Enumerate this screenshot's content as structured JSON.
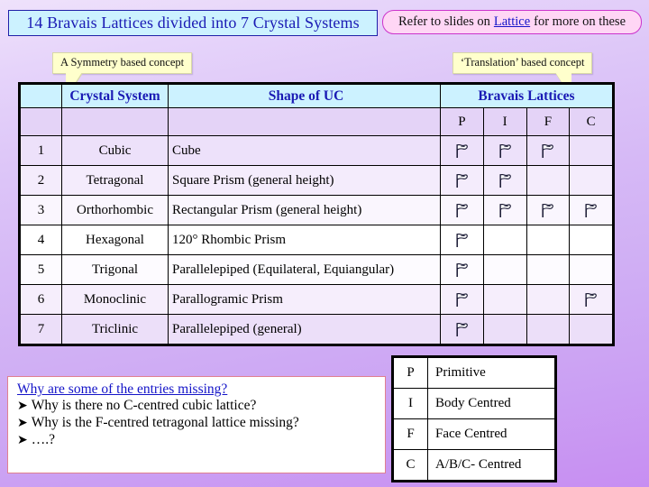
{
  "title_bar": {
    "text": "14 Bravais Lattices divided into 7 Crystal Systems"
  },
  "refer_bar": {
    "before": "Refer to slides on",
    "link": "Lattice",
    "after": "for more on these"
  },
  "callouts": {
    "left": "A Symmetry based concept",
    "right": "‘Translation’ based concept"
  },
  "table": {
    "headers": {
      "blank": "",
      "crystal_system": "Crystal System",
      "shape_of_uc": "Shape of UC",
      "bravais_lattices": "Bravais Lattices"
    },
    "sub_headers": [
      "P",
      "I",
      "F",
      "C"
    ],
    "rows": [
      {
        "num": "1",
        "system": "Cubic",
        "shape": "Cube",
        "P": true,
        "I": true,
        "F": true,
        "C": false
      },
      {
        "num": "2",
        "system": "Tetragonal",
        "shape": "Square Prism (general height)",
        "P": true,
        "I": true,
        "F": false,
        "C": false
      },
      {
        "num": "3",
        "system": "Orthorhombic",
        "shape": "Rectangular Prism (general height)",
        "P": true,
        "I": true,
        "F": true,
        "C": true
      },
      {
        "num": "4",
        "system": "Hexagonal",
        "shape": "120° Rhombic Prism",
        "P": true,
        "I": false,
        "F": false,
        "C": false
      },
      {
        "num": "5",
        "system": "Trigonal",
        "shape": "Parallelepiped (Equilateral, Equiangular)",
        "P": true,
        "I": false,
        "F": false,
        "C": false
      },
      {
        "num": "6",
        "system": "Monoclinic",
        "shape": "Parallogramic Prism",
        "P": true,
        "I": false,
        "F": false,
        "C": true
      },
      {
        "num": "7",
        "system": "Triclinic",
        "shape": "Parallelepiped (general)",
        "P": true,
        "I": false,
        "F": false,
        "C": false
      }
    ]
  },
  "question_box": {
    "heading": "Why are some of the entries missing?",
    "bullets": [
      "Why is there no C-centred cubic lattice?",
      "Why is the F-centred tetragonal lattice missing?",
      "….?"
    ],
    "bullet_marker": "➤"
  },
  "legend": {
    "rows": [
      {
        "key": "P",
        "value": "Primitive"
      },
      {
        "key": "I",
        "value": "Body Centred"
      },
      {
        "key": "F",
        "value": "Face Centred"
      },
      {
        "key": "C",
        "value": "A/B/C- Centred"
      }
    ]
  },
  "colors": {
    "title_bg": "#ccf2ff",
    "title_text": "#1a1ab4",
    "refer_bg": "#ffd6f5",
    "refer_border": "#cc33cc",
    "link": "#1414c8",
    "callout_bg": "#ffffcc",
    "header_bg": "#ccf2ff",
    "subheader_bg": "#e4d3f7",
    "question_border": "#e08090",
    "background_top": "#efe2fb",
    "background_bottom": "#c78ef2"
  },
  "icons": {
    "marker": "pennant-flag-icon"
  }
}
